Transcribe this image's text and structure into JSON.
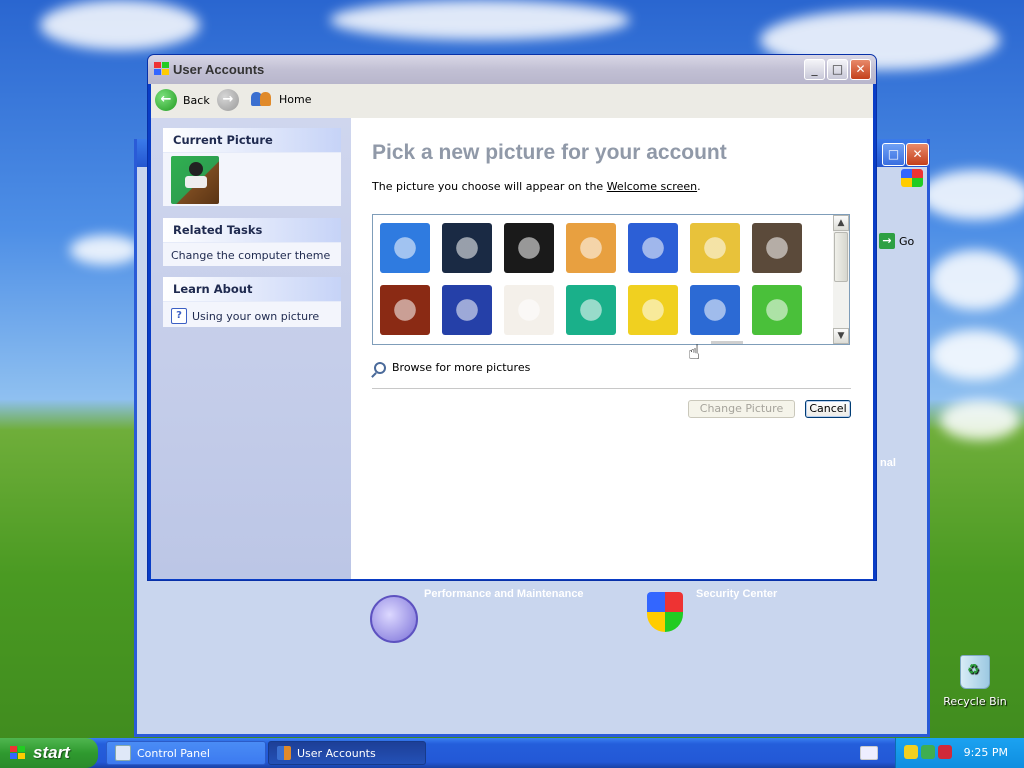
{
  "window": {
    "title": "User Accounts",
    "controls": {
      "minimize": "_",
      "maximize": "□",
      "close": "✕"
    }
  },
  "toolbar": {
    "back_label": "Back",
    "home_label": "Home"
  },
  "sidebar": {
    "current_picture": {
      "header": "Current Picture"
    },
    "related_tasks": {
      "header": "Related Tasks",
      "items": [
        "Change the computer theme"
      ]
    },
    "learn_about": {
      "header": "Learn About",
      "items": [
        "Using your own picture"
      ]
    }
  },
  "main": {
    "heading": "Pick a new picture for your account",
    "description_before": "The picture you choose will appear on the ",
    "description_link": "Welcome screen",
    "description_after": ".",
    "pictures": [
      {
        "name": "airplane",
        "color": "#2f7be0"
      },
      {
        "name": "astronaut",
        "color": "#1a2a44"
      },
      {
        "name": "soccer-ball",
        "color": "#1a1a1a"
      },
      {
        "name": "beach-chairs",
        "color": "#e8a040"
      },
      {
        "name": "butterfly",
        "color": "#2c5fd6"
      },
      {
        "name": "race-car",
        "color": "#e8c23a"
      },
      {
        "name": "owl",
        "color": "#5b4a3a"
      },
      {
        "name": "chess",
        "color": "#8a2a14"
      },
      {
        "name": "dirt-bike",
        "color": "#2540a8"
      },
      {
        "name": "dog",
        "color": "#f4f0ea"
      },
      {
        "name": "drip",
        "color": "#1ab08a"
      },
      {
        "name": "duck",
        "color": "#f0d020"
      },
      {
        "name": "fish",
        "color": "#2c6ad4"
      },
      {
        "name": "frog",
        "color": "#4ac03a"
      }
    ],
    "browse_label": "Browse for more pictures",
    "change_button": "Change Picture",
    "cancel_button": "Cancel"
  },
  "background_window": {
    "go_label": "Go",
    "items": [
      "Performance and Maintenance",
      "Security Center"
    ],
    "partial_text": "nal"
  },
  "desktop": {
    "recycle_bin_label": "Recycle Bin"
  },
  "taskbar": {
    "start_label": "start",
    "tasks": [
      "Control Panel",
      "User Accounts"
    ],
    "clock": "9:25 PM"
  }
}
